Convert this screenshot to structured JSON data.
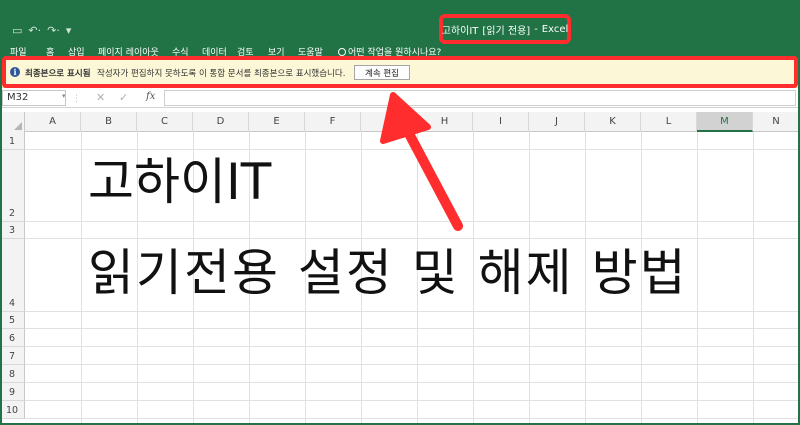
{
  "window": {
    "qat_icons": [
      "save-icon",
      "undo-icon",
      "redo-icon",
      "customize-icon"
    ],
    "title": "고하이IT",
    "title_mode": "[읽기 전용]",
    "title_sep": "-",
    "app_name": "Excel"
  },
  "menu": {
    "items": [
      "파일",
      "홈",
      "삽입",
      "페이지 레이아웃",
      "수식",
      "데이터",
      "검토",
      "보기",
      "도움말"
    ],
    "tell_me": "어떤 작업을 원하시나요?"
  },
  "infobar": {
    "icon": "info-icon",
    "bold_label": "최종본으로 표시됨",
    "message": "작성자가 편집하지 못하도록 이 통합 문서를 최종본으로 표시했습니다.",
    "button_label": "계속 편집"
  },
  "formula_bar": {
    "name_box": "M32",
    "cancel_icon": "✕",
    "enter_icon": "✓",
    "fx_label": "fx",
    "formula_value": ""
  },
  "grid": {
    "columns": [
      "A",
      "B",
      "C",
      "D",
      "E",
      "F",
      "G",
      "H",
      "I",
      "J",
      "K",
      "L",
      "M",
      "N"
    ],
    "selected_column": "M",
    "rows": [
      "1",
      "2",
      "3",
      "4",
      "5",
      "6",
      "7",
      "8",
      "9",
      "10"
    ],
    "cells": {
      "B2": "고하이IT",
      "B4": "읽기전용 설정 및 해제 방법"
    }
  },
  "colors": {
    "excel_green": "#217346",
    "annotation_red": "#ff2d2d",
    "infobar_bg": "#fcf7d6"
  }
}
